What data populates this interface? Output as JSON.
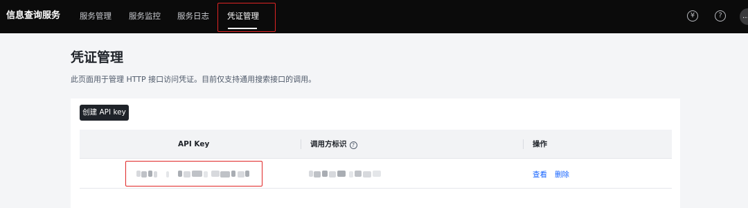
{
  "app": {
    "brand": "信息查询服务"
  },
  "nav": {
    "items": [
      {
        "label": "服务管理"
      },
      {
        "label": "服务监控"
      },
      {
        "label": "服务日志"
      },
      {
        "label": "凭证管理"
      }
    ],
    "active_index": 3
  },
  "header_icons": {
    "currency": {
      "icon": "yen-icon",
      "glyph": "¥"
    },
    "help": {
      "icon": "question-icon",
      "glyph": "?"
    },
    "user": {
      "icon": "user-avatar-icon",
      "glyph": "…"
    }
  },
  "page": {
    "title": "凭证管理",
    "description": "此页面用于管理 HTTP 接口访问凭证。目前仅支持通用搜索接口的调用。"
  },
  "toolbar": {
    "create_label": "创建 API key"
  },
  "table": {
    "columns": [
      {
        "label": "API Key"
      },
      {
        "label": "调用方标识"
      },
      {
        "label": "操作"
      }
    ],
    "rows": [
      {
        "api_key": "",
        "caller_id": "",
        "actions": [
          {
            "label": "查看"
          },
          {
            "label": "删除"
          }
        ]
      }
    ]
  },
  "colors": {
    "topbar_bg": "#0b0b0b",
    "link": "#1664ff",
    "highlight": "#e02424",
    "primary_button": "#1f2329"
  }
}
